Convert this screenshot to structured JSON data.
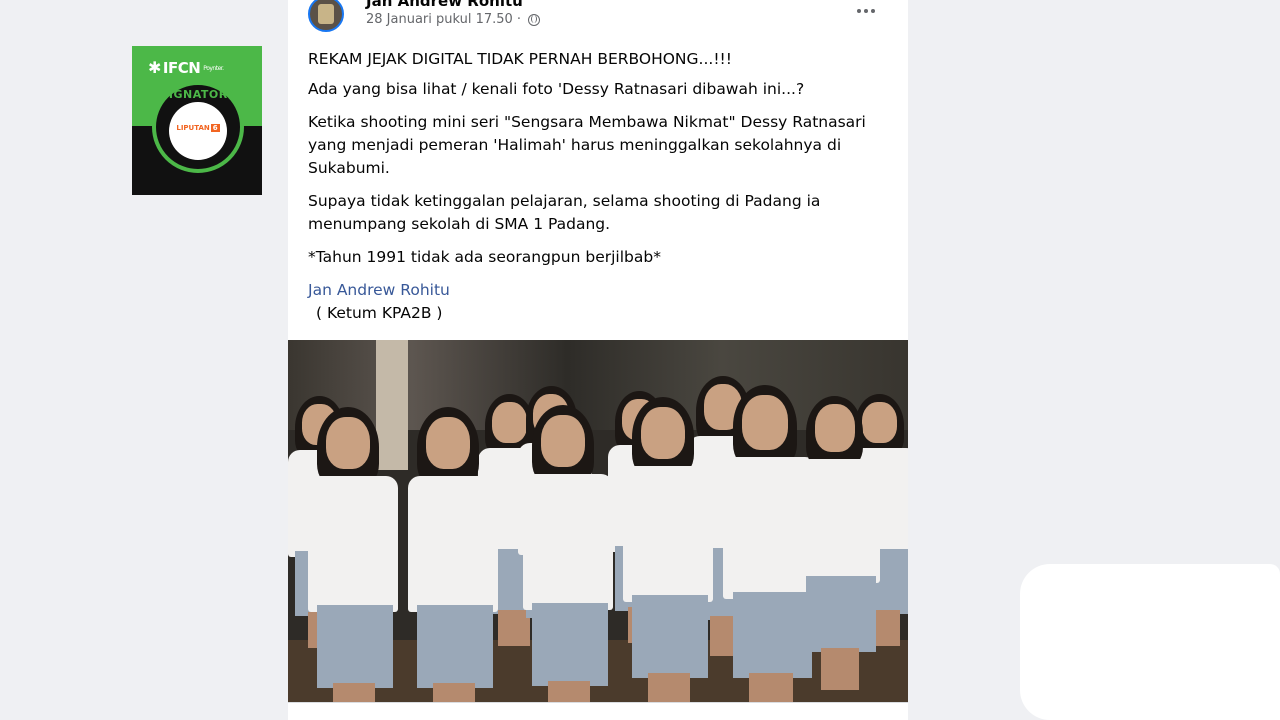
{
  "badge": {
    "logo": "IFCN",
    "logo_sub": "Poynter.",
    "ring_text": "SIGNATORY",
    "brand": "LIPUTAN",
    "brand_number": "6",
    "colors": {
      "green": "#4cb848",
      "dark": "#111111",
      "brand": "#f26522"
    }
  },
  "post": {
    "author": "Jan Andrew Rohitu",
    "timestamp": "28 Januari pukul 17.50",
    "privacy_icon": "globe-icon",
    "more_icon": "more-options-icon",
    "paragraphs": [
      "REKAM JEJAK DIGITAL TIDAK PERNAH BERBOHONG...!!!",
      "Ada yang bisa lihat / kenali foto 'Dessy Ratnasari dibawah ini...?",
      "Ketika shooting mini seri \"Sengsara Membawa Nikmat\" Dessy Ratnasari yang menjadi pemeran 'Halimah' harus meninggalkan sekolahnya di Sukabumi.",
      "Supaya tidak ketinggalan pelajaran, selama shooting di Padang ia menumpang sekolah di SMA 1 Padang.",
      "*Tahun 1991 tidak ada seorangpun berjilbab*"
    ],
    "signature_link": "Jan Andrew Rohitu",
    "signature_sub": "( Ketum KPA2B )",
    "link_color": "#385898"
  },
  "photo": {
    "subject": "group-photo"
  }
}
